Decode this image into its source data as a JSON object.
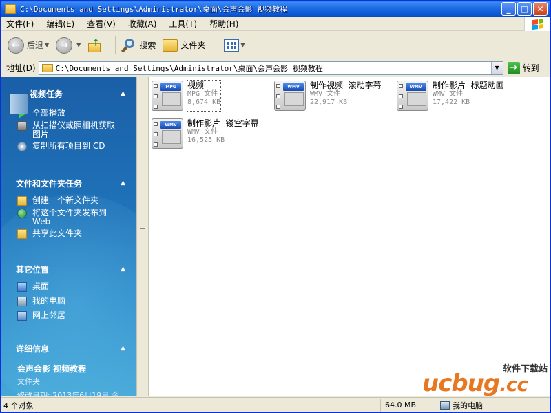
{
  "window": {
    "title": "C:\\Documents and Settings\\Administrator\\桌面\\会声会影  视频教程",
    "minimize": "_",
    "maximize": "□",
    "close": "✕"
  },
  "menu": [
    "文件(F)",
    "编辑(E)",
    "查看(V)",
    "收藏(A)",
    "工具(T)",
    "帮助(H)"
  ],
  "toolbar": {
    "back_label": "后退",
    "search_label": "搜索",
    "folders_label": "文件夹"
  },
  "address": {
    "label": "地址(D)",
    "value": "C:\\Documents and Settings\\Administrator\\桌面\\会声会影  视频教程",
    "go_label": "转到"
  },
  "taskpane": {
    "video_tasks": {
      "title": "视频任务",
      "items": [
        "全部播放",
        "从扫描仪或照相机获取图片",
        "复制所有项目到 CD"
      ]
    },
    "file_tasks": {
      "title": "文件和文件夹任务",
      "items": [
        "创建一个新文件夹",
        "将这个文件夹发布到 Web",
        "共享此文件夹"
      ]
    },
    "other_places": {
      "title": "其它位置",
      "items": [
        "桌面",
        "我的电脑",
        "网上邻居"
      ]
    },
    "details": {
      "title": "详细信息",
      "name": "会声会影  视频教程",
      "type": "文件夹",
      "modified": "修改日期: 2013年6月19日 今"
    }
  },
  "files": [
    {
      "name": "视频",
      "type": "MPG 文件",
      "size": "8,674 KB",
      "tag": "MPG"
    },
    {
      "name": "制作视频  滚动字幕",
      "type": "WMV 文件",
      "size": "22,917 KB",
      "tag": "WMV"
    },
    {
      "name": "制作影片  标题动画",
      "type": "WMV 文件",
      "size": "17,422 KB",
      "tag": "WMV"
    },
    {
      "name": "制作影片  镂空字幕",
      "type": "WMV 文件",
      "size": "16,525 KB",
      "tag": "WMV"
    }
  ],
  "status": {
    "count": "4 个对象",
    "size": "64.0 MB",
    "location": "我的电脑"
  },
  "watermark": {
    "top": "软件下载站",
    "logo": "ucbug",
    "suffix": ".cc"
  }
}
